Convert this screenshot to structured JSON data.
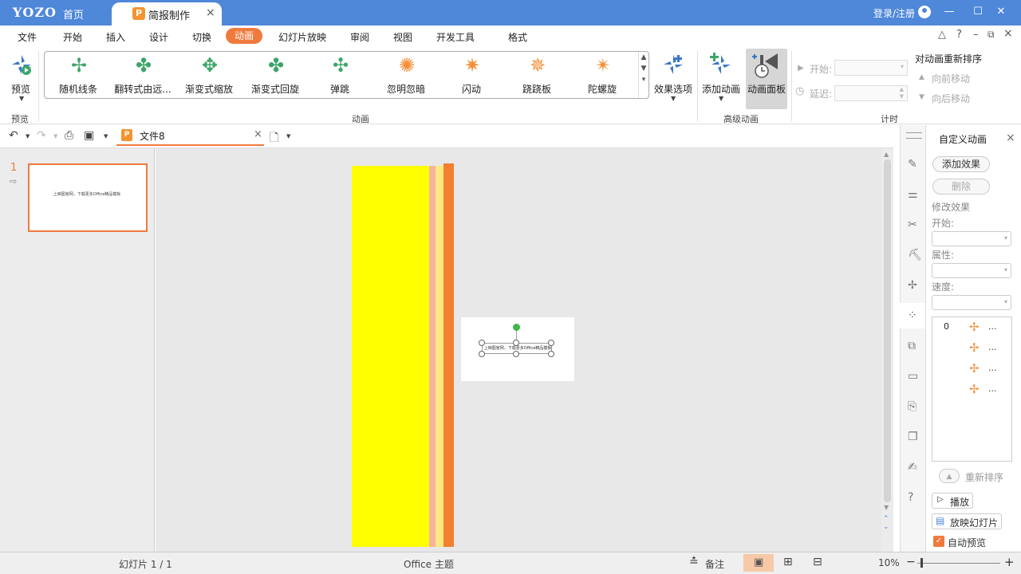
{
  "app": {
    "logo": "YOZO",
    "home": "首页"
  },
  "tab": {
    "icon": "P",
    "label": "简报制作",
    "close": "×"
  },
  "topright": {
    "login": "登录/注册",
    "minimize": "—",
    "maximize": "☐",
    "close": "✕"
  },
  "menus": [
    "文件",
    "开始",
    "插入",
    "设计",
    "切换",
    "动画",
    "幻灯片放映",
    "审阅",
    "视图",
    "开发工具",
    "格式"
  ],
  "menu_active": "动画",
  "help_icons": {
    "up": "△",
    "help": "?",
    "min": "–",
    "restore": "⧉",
    "close": "×"
  },
  "ribbon": {
    "preview_label": "预览",
    "preview_group": "预览",
    "effects": [
      "随机线条",
      "翻转式由远...",
      "渐变式缩放",
      "渐变式回旋",
      "弹跳",
      "忽明忽暗",
      "闪动",
      "跷跷板",
      "陀螺旋"
    ],
    "anim_group": "动画",
    "effect_options": "效果选项",
    "add_anim": "添加动画",
    "anim_panel": "动画面板",
    "adv_group": "高级动画",
    "start_label": "开始:",
    "delay_label": "延迟:",
    "timing_group": "计时",
    "reorder_title": "对动画重新排序",
    "move_forward": "向前移动",
    "move_back": "向后移动"
  },
  "quickbar": {
    "file_tab": "文件8",
    "close": "×"
  },
  "slides": {
    "number": "1",
    "thumb_text": "上映图官网，下载更多Office精品模板"
  },
  "canvas": {
    "box_text": "上映图官网，下载更多Office精品模板"
  },
  "panel": {
    "title": "自定义动画",
    "close": "×",
    "add_effect": "添加效果",
    "delete": "删除",
    "modify": "修改效果",
    "start": "开始:",
    "property": "属性:",
    "speed": "速度:",
    "list_index": "0",
    "items": [
      "...",
      "...",
      "...",
      "..."
    ],
    "reorder": "重新排序",
    "play": "播放",
    "slideshow": "放映幻灯片",
    "autopreview": "自动预览"
  },
  "status": {
    "slide": "幻灯片 1 / 1",
    "theme": "Office 主题",
    "notes": "备注",
    "zoom": "10%"
  },
  "colors": {
    "titlebar": "#4f87d9",
    "accent": "#f07a3e",
    "yellow": "#ffff00",
    "pink": "#f5b4a0",
    "lightyellow": "#ffe680",
    "deeporange": "#f28030"
  }
}
